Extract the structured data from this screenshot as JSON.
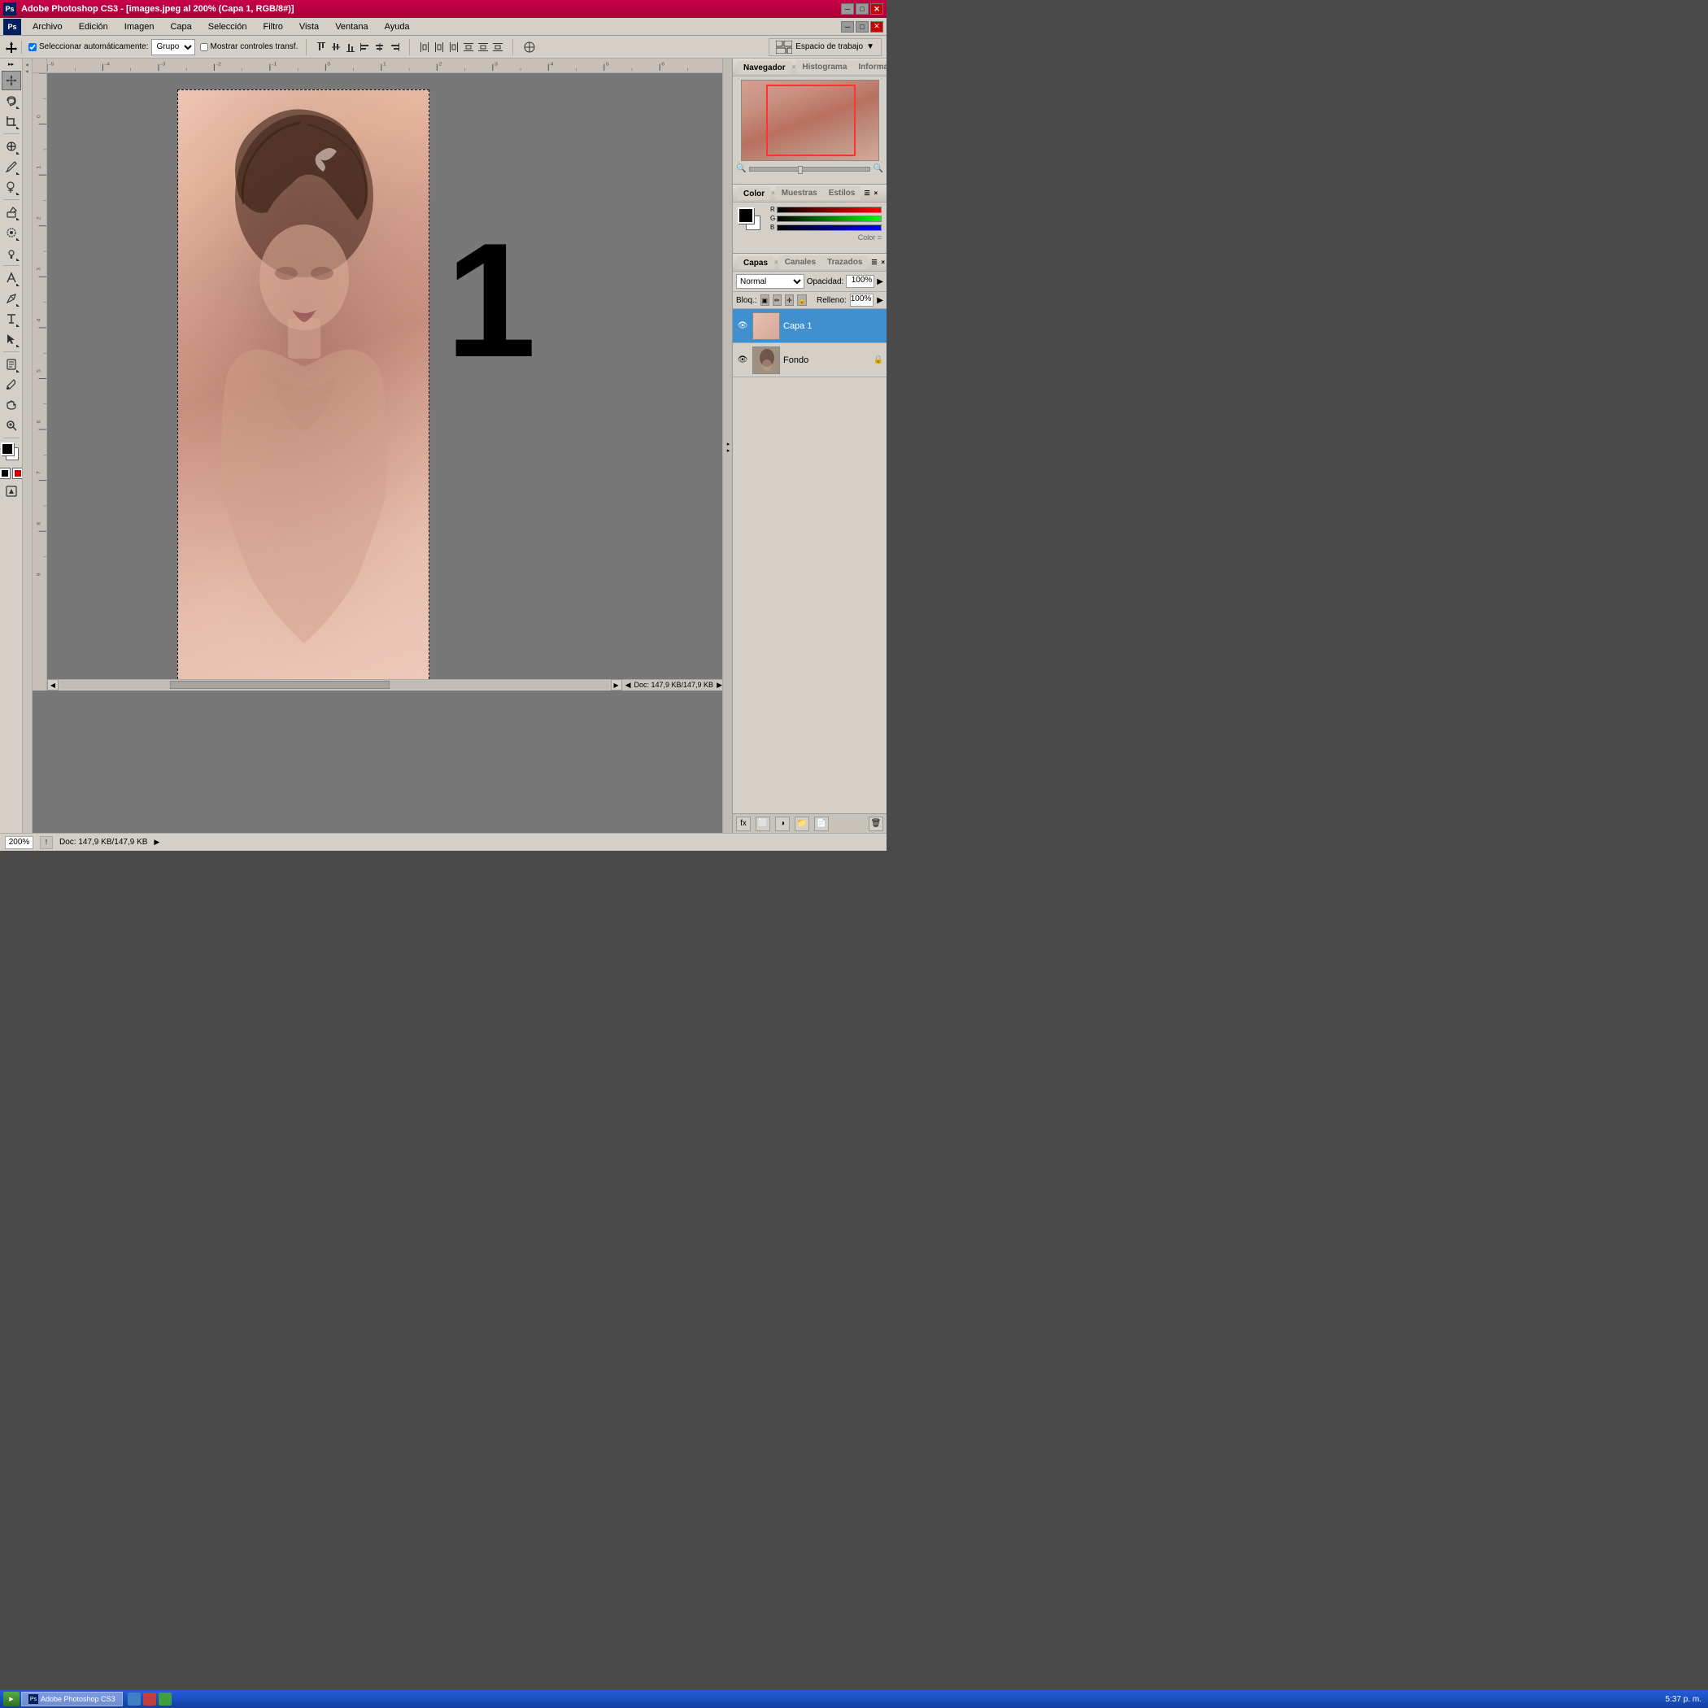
{
  "titleBar": {
    "title": "Adobe Photoshop CS3 - [images.jpeg al 200% (Capa 1, RGB/8#)]",
    "minimize": "─",
    "maximize": "□",
    "close": "✕"
  },
  "menuBar": {
    "items": [
      "Archivo",
      "Edición",
      "Imagen",
      "Capa",
      "Selección",
      "Filtro",
      "Vista",
      "Ventana",
      "Ayuda"
    ]
  },
  "optionsBar": {
    "autoSelectLabel": "Seleccionar automáticamente:",
    "autoSelectValue": "Grupo",
    "showTransformLabel": "Mostrar controles transf.",
    "workspaceLabel": "Espacio de trabajo",
    "workspaceDropdown": "▼"
  },
  "panels": {
    "navigator": {
      "title": "Navegador",
      "tabs": [
        "Navegador",
        "Histograma",
        "Información"
      ]
    },
    "color": {
      "title": "Color",
      "tabs": [
        "Color",
        "Muestras",
        "Estilos"
      ],
      "colorEquals": "Color ="
    },
    "layers": {
      "title": "Capas",
      "tabs": [
        "Capas",
        "Canales",
        "Trazados"
      ],
      "blendMode": "Normal",
      "opacityLabel": "Opacidad:",
      "opacityValue": "100%",
      "lockLabel": "Bloq.:",
      "fillLabel": "Relleno:",
      "fillValue": "100%",
      "layers": [
        {
          "name": "Capa 1",
          "visible": true,
          "active": true,
          "thumbColor": "pink",
          "locked": false
        },
        {
          "name": "Fondo",
          "visible": true,
          "active": false,
          "thumbColor": "photo",
          "locked": true
        }
      ]
    }
  },
  "statusBar": {
    "zoom": "200%",
    "docSize": "Doc: 147,9 KB/147,9 KB",
    "time": "5:37 p. m."
  },
  "canvas": {
    "bigNumber": "1"
  },
  "taskbar": {
    "buttons": [
      "Inicio",
      "Photoshop CS3"
    ]
  },
  "tools": [
    "↖",
    "⬚",
    "✂",
    "✏",
    "⬡",
    "⬗",
    "✒",
    "⌨",
    "➜",
    "⊕",
    "🪣",
    "🖊",
    "📐",
    "🔍"
  ]
}
